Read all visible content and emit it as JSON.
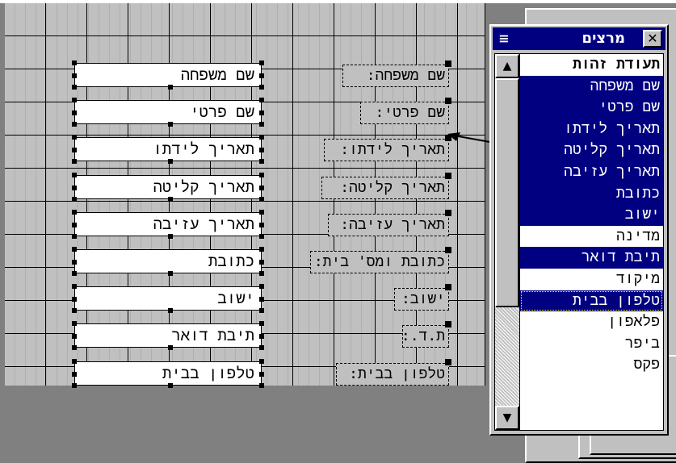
{
  "form": {
    "fields": [
      {
        "label": "שם משפחה:",
        "control": "שם משפחה"
      },
      {
        "label": "שם פרטי:",
        "control": "שם פרטי"
      },
      {
        "label": "תאריך לידתו:",
        "control": "תאריך לידתו"
      },
      {
        "label": "תאריך קליטה:",
        "control": "תאריך קליטה"
      },
      {
        "label": "תאריך עזיבה:",
        "control": "תאריך עזיבה"
      },
      {
        "label": "כתובת ומס' בית:",
        "control": "כתובת"
      },
      {
        "label": "ישוב:",
        "control": "ישוב"
      },
      {
        "label": "ת.ד.:",
        "control": "תיבת דואר"
      },
      {
        "label": "טלפון בבית:",
        "control": "טלפון בבית"
      }
    ]
  },
  "palette": {
    "title": "מרצים",
    "close_icon": "close-icon",
    "menu_icon": "control-menu-icon",
    "items": [
      {
        "text": "תעודת זהות",
        "selected": false,
        "header": true
      },
      {
        "text": "שם משפחה",
        "selected": true
      },
      {
        "text": "שם פרטי",
        "selected": true
      },
      {
        "text": "תאריך לידתו",
        "selected": true
      },
      {
        "text": "תאריך קליטה",
        "selected": true
      },
      {
        "text": "תאריך עזיבה",
        "selected": true
      },
      {
        "text": "כתובת",
        "selected": true
      },
      {
        "text": "ישוב",
        "selected": true
      },
      {
        "text": "מדינה",
        "selected": false
      },
      {
        "text": "תיבת דואר",
        "selected": true
      },
      {
        "text": "מיקוד",
        "selected": false
      },
      {
        "text": "טלפון בבית",
        "selected": true,
        "focused": true
      },
      {
        "text": "פלאפון",
        "selected": false
      },
      {
        "text": "ביפר",
        "selected": false
      },
      {
        "text": "פקס",
        "selected": false
      }
    ],
    "scroll_up_icon": "scroll-up-arrow-icon",
    "scroll_down_icon": "scroll-down-arrow-icon"
  },
  "colors": {
    "selection": "#000080",
    "face": "#c0c0c0",
    "desktop": "#808080"
  }
}
